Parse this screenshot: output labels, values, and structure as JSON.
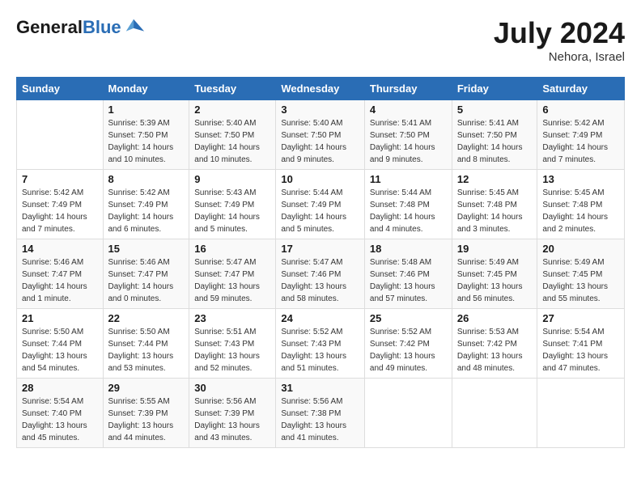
{
  "header": {
    "logo_line1": "General",
    "logo_line2": "Blue",
    "month_title": "July 2024",
    "location": "Nehora, Israel"
  },
  "days_of_week": [
    "Sunday",
    "Monday",
    "Tuesday",
    "Wednesday",
    "Thursday",
    "Friday",
    "Saturday"
  ],
  "weeks": [
    [
      {
        "day": "",
        "sunrise": "",
        "sunset": "",
        "daylight": ""
      },
      {
        "day": "1",
        "sunrise": "Sunrise: 5:39 AM",
        "sunset": "Sunset: 7:50 PM",
        "daylight": "Daylight: 14 hours and 10 minutes."
      },
      {
        "day": "2",
        "sunrise": "Sunrise: 5:40 AM",
        "sunset": "Sunset: 7:50 PM",
        "daylight": "Daylight: 14 hours and 10 minutes."
      },
      {
        "day": "3",
        "sunrise": "Sunrise: 5:40 AM",
        "sunset": "Sunset: 7:50 PM",
        "daylight": "Daylight: 14 hours and 9 minutes."
      },
      {
        "day": "4",
        "sunrise": "Sunrise: 5:41 AM",
        "sunset": "Sunset: 7:50 PM",
        "daylight": "Daylight: 14 hours and 9 minutes."
      },
      {
        "day": "5",
        "sunrise": "Sunrise: 5:41 AM",
        "sunset": "Sunset: 7:50 PM",
        "daylight": "Daylight: 14 hours and 8 minutes."
      },
      {
        "day": "6",
        "sunrise": "Sunrise: 5:42 AM",
        "sunset": "Sunset: 7:49 PM",
        "daylight": "Daylight: 14 hours and 7 minutes."
      }
    ],
    [
      {
        "day": "7",
        "sunrise": "Sunrise: 5:42 AM",
        "sunset": "Sunset: 7:49 PM",
        "daylight": "Daylight: 14 hours and 7 minutes."
      },
      {
        "day": "8",
        "sunrise": "Sunrise: 5:42 AM",
        "sunset": "Sunset: 7:49 PM",
        "daylight": "Daylight: 14 hours and 6 minutes."
      },
      {
        "day": "9",
        "sunrise": "Sunrise: 5:43 AM",
        "sunset": "Sunset: 7:49 PM",
        "daylight": "Daylight: 14 hours and 5 minutes."
      },
      {
        "day": "10",
        "sunrise": "Sunrise: 5:44 AM",
        "sunset": "Sunset: 7:49 PM",
        "daylight": "Daylight: 14 hours and 5 minutes."
      },
      {
        "day": "11",
        "sunrise": "Sunrise: 5:44 AM",
        "sunset": "Sunset: 7:48 PM",
        "daylight": "Daylight: 14 hours and 4 minutes."
      },
      {
        "day": "12",
        "sunrise": "Sunrise: 5:45 AM",
        "sunset": "Sunset: 7:48 PM",
        "daylight": "Daylight: 14 hours and 3 minutes."
      },
      {
        "day": "13",
        "sunrise": "Sunrise: 5:45 AM",
        "sunset": "Sunset: 7:48 PM",
        "daylight": "Daylight: 14 hours and 2 minutes."
      }
    ],
    [
      {
        "day": "14",
        "sunrise": "Sunrise: 5:46 AM",
        "sunset": "Sunset: 7:47 PM",
        "daylight": "Daylight: 14 hours and 1 minute."
      },
      {
        "day": "15",
        "sunrise": "Sunrise: 5:46 AM",
        "sunset": "Sunset: 7:47 PM",
        "daylight": "Daylight: 14 hours and 0 minutes."
      },
      {
        "day": "16",
        "sunrise": "Sunrise: 5:47 AM",
        "sunset": "Sunset: 7:47 PM",
        "daylight": "Daylight: 13 hours and 59 minutes."
      },
      {
        "day": "17",
        "sunrise": "Sunrise: 5:47 AM",
        "sunset": "Sunset: 7:46 PM",
        "daylight": "Daylight: 13 hours and 58 minutes."
      },
      {
        "day": "18",
        "sunrise": "Sunrise: 5:48 AM",
        "sunset": "Sunset: 7:46 PM",
        "daylight": "Daylight: 13 hours and 57 minutes."
      },
      {
        "day": "19",
        "sunrise": "Sunrise: 5:49 AM",
        "sunset": "Sunset: 7:45 PM",
        "daylight": "Daylight: 13 hours and 56 minutes."
      },
      {
        "day": "20",
        "sunrise": "Sunrise: 5:49 AM",
        "sunset": "Sunset: 7:45 PM",
        "daylight": "Daylight: 13 hours and 55 minutes."
      }
    ],
    [
      {
        "day": "21",
        "sunrise": "Sunrise: 5:50 AM",
        "sunset": "Sunset: 7:44 PM",
        "daylight": "Daylight: 13 hours and 54 minutes."
      },
      {
        "day": "22",
        "sunrise": "Sunrise: 5:50 AM",
        "sunset": "Sunset: 7:44 PM",
        "daylight": "Daylight: 13 hours and 53 minutes."
      },
      {
        "day": "23",
        "sunrise": "Sunrise: 5:51 AM",
        "sunset": "Sunset: 7:43 PM",
        "daylight": "Daylight: 13 hours and 52 minutes."
      },
      {
        "day": "24",
        "sunrise": "Sunrise: 5:52 AM",
        "sunset": "Sunset: 7:43 PM",
        "daylight": "Daylight: 13 hours and 51 minutes."
      },
      {
        "day": "25",
        "sunrise": "Sunrise: 5:52 AM",
        "sunset": "Sunset: 7:42 PM",
        "daylight": "Daylight: 13 hours and 49 minutes."
      },
      {
        "day": "26",
        "sunrise": "Sunrise: 5:53 AM",
        "sunset": "Sunset: 7:42 PM",
        "daylight": "Daylight: 13 hours and 48 minutes."
      },
      {
        "day": "27",
        "sunrise": "Sunrise: 5:54 AM",
        "sunset": "Sunset: 7:41 PM",
        "daylight": "Daylight: 13 hours and 47 minutes."
      }
    ],
    [
      {
        "day": "28",
        "sunrise": "Sunrise: 5:54 AM",
        "sunset": "Sunset: 7:40 PM",
        "daylight": "Daylight: 13 hours and 45 minutes."
      },
      {
        "day": "29",
        "sunrise": "Sunrise: 5:55 AM",
        "sunset": "Sunset: 7:39 PM",
        "daylight": "Daylight: 13 hours and 44 minutes."
      },
      {
        "day": "30",
        "sunrise": "Sunrise: 5:56 AM",
        "sunset": "Sunset: 7:39 PM",
        "daylight": "Daylight: 13 hours and 43 minutes."
      },
      {
        "day": "31",
        "sunrise": "Sunrise: 5:56 AM",
        "sunset": "Sunset: 7:38 PM",
        "daylight": "Daylight: 13 hours and 41 minutes."
      },
      {
        "day": "",
        "sunrise": "",
        "sunset": "",
        "daylight": ""
      },
      {
        "day": "",
        "sunrise": "",
        "sunset": "",
        "daylight": ""
      },
      {
        "day": "",
        "sunrise": "",
        "sunset": "",
        "daylight": ""
      }
    ]
  ]
}
